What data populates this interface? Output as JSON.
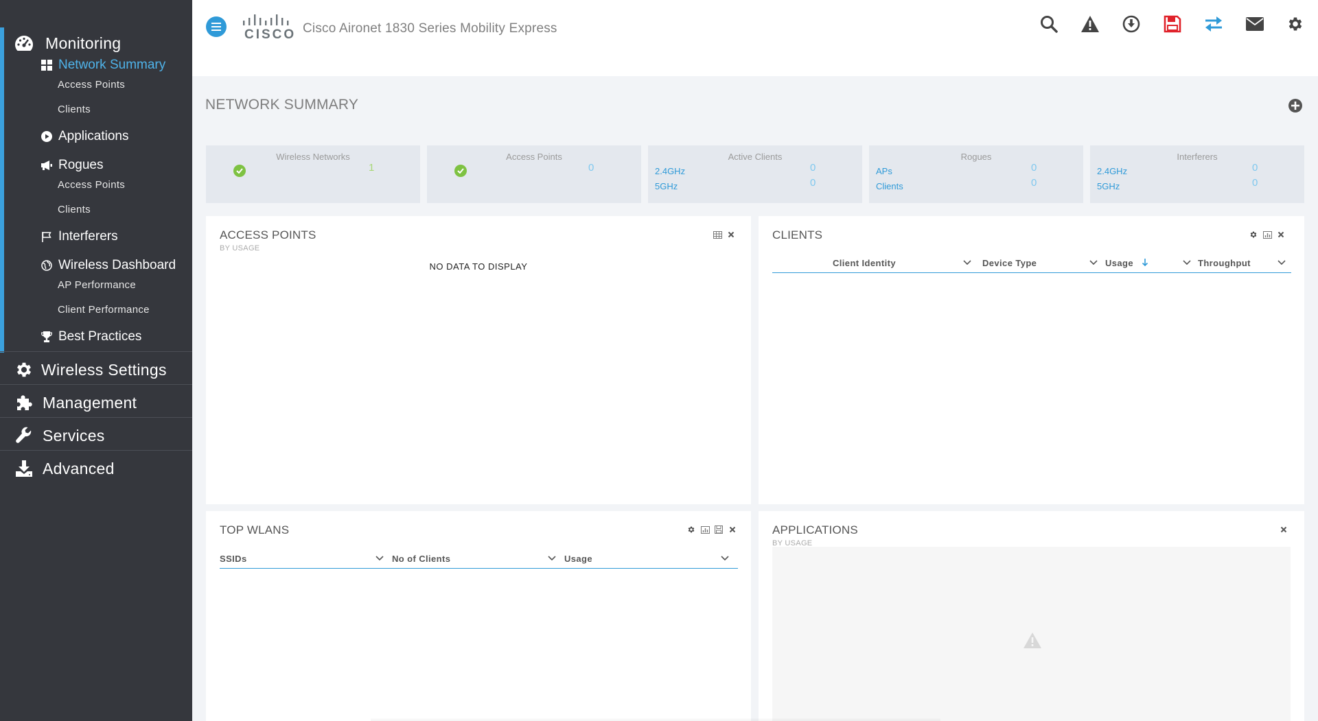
{
  "app": {
    "title": "Cisco Aironet 1830 Series Mobility Express",
    "logo_text": "CISCO"
  },
  "sidebar": {
    "monitoring": {
      "label": "Monitoring",
      "network_summary": "Network Summary",
      "ns_access_points": "Access Points",
      "ns_clients": "Clients",
      "applications": "Applications",
      "rogues": "Rogues",
      "rogues_access_points": "Access Points",
      "rogues_clients": "Clients",
      "interferers": "Interferers",
      "wireless_dashboard": "Wireless Dashboard",
      "ap_performance": "AP Performance",
      "client_performance": "Client Performance",
      "best_practices": "Best Practices"
    },
    "wireless_settings": "Wireless Settings",
    "management": "Management",
    "services": "Services",
    "advanced": "Advanced"
  },
  "header_icons": [
    "search-icon",
    "alert-icon",
    "download-icon",
    "save-icon",
    "transfer-icon",
    "mail-icon",
    "settings-icon"
  ],
  "colors": {
    "accent": "#2f9ad8",
    "sidebar_bg": "#35373d",
    "save_icon": "#e0232b",
    "ok_green": "#7ec242"
  },
  "main": {
    "title": "NETWORK SUMMARY",
    "tiles": {
      "wireless_networks": {
        "title": "Wireless Networks",
        "value": "1"
      },
      "access_points": {
        "title": "Access Points",
        "value": "0"
      },
      "active_clients": {
        "title": "Active Clients",
        "band1": "2.4GHz",
        "band1_value": "0",
        "band2": "5GHz",
        "band2_value": "0"
      },
      "rogues": {
        "title": "Rogues",
        "row1": "APs",
        "row1_value": "0",
        "row2": "Clients",
        "row2_value": "0"
      },
      "interferers": {
        "title": "Interferers",
        "band1": "2.4GHz",
        "band1_value": "0",
        "band2": "5GHz",
        "band2_value": "0"
      }
    },
    "panels": {
      "access_points": {
        "title": "ACCESS POINTS",
        "subtitle": "BY USAGE",
        "empty": "NO DATA TO DISPLAY"
      },
      "clients": {
        "title": "CLIENTS",
        "columns": [
          "Client Identity",
          "Device Type",
          "Usage",
          "Throughput"
        ]
      },
      "top_wlans": {
        "title": "TOP WLANS",
        "columns": [
          "SSIDs",
          "No of Clients",
          "Usage"
        ]
      },
      "applications": {
        "title": "APPLICATIONS",
        "subtitle": "BY USAGE"
      }
    }
  }
}
